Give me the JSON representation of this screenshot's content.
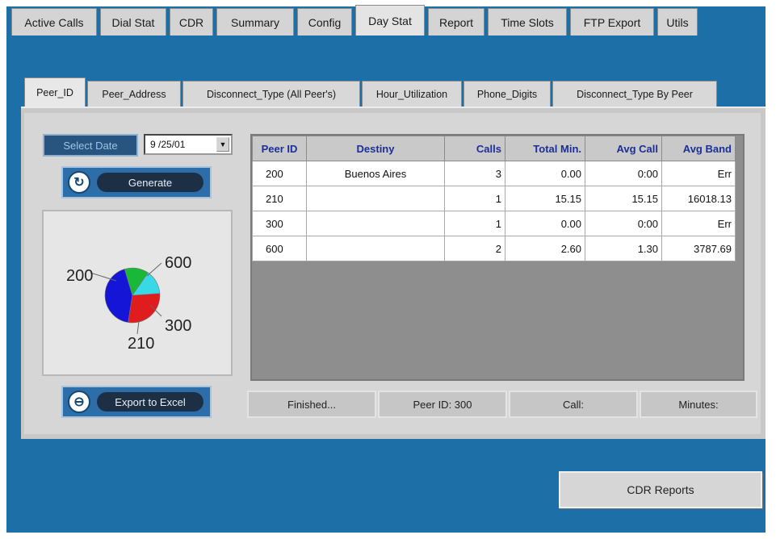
{
  "top_tabs": [
    {
      "label": "Active Calls"
    },
    {
      "label": "Dial Stat"
    },
    {
      "label": "CDR"
    },
    {
      "label": "Summary"
    },
    {
      "label": "Config"
    },
    {
      "label": "Day Stat"
    },
    {
      "label": "Report"
    },
    {
      "label": "Time Slots"
    },
    {
      "label": "FTP Export"
    },
    {
      "label": "Utils"
    }
  ],
  "top_tabs_active": "Day Stat",
  "sub_tabs": [
    {
      "label": "Peer_ID"
    },
    {
      "label": "Peer_Address"
    },
    {
      "label": "Disconnect_Type (All Peer's)"
    },
    {
      "label": "Hour_Utilization"
    },
    {
      "label": "Phone_Digits"
    },
    {
      "label": "Disconnect_Type By Peer"
    }
  ],
  "sub_tabs_active": "Peer_ID",
  "controls": {
    "select_date_label": "Select Date",
    "date_value": "9 /25/01",
    "generate_label": "Generate",
    "export_label": "Export to Excel"
  },
  "pie": {
    "labels": [
      "200",
      "600",
      "300",
      "210"
    ],
    "slices": [
      {
        "peer": "200",
        "value": 3,
        "color": "#1515d8"
      },
      {
        "peer": "210",
        "value": 1,
        "color": "#19b838"
      },
      {
        "peer": "300",
        "value": 1,
        "color": "#38d8e6"
      },
      {
        "peer": "600",
        "value": 2,
        "color": "#e01c1c"
      }
    ]
  },
  "table": {
    "headers": [
      "Peer ID",
      "Destiny",
      "Calls",
      "Total Min.",
      "Avg Call",
      "Avg Band"
    ],
    "rows": [
      [
        "200",
        "Buenos Aires",
        "3",
        "0.00",
        "0:00",
        "Err"
      ],
      [
        "210",
        "",
        "1",
        "15.15",
        "15.15",
        "16018.13"
      ],
      [
        "300",
        "",
        "1",
        "0.00",
        "0:00",
        "Err"
      ],
      [
        "600",
        "",
        "2",
        "2.60",
        "1.30",
        "3787.69"
      ]
    ]
  },
  "status": {
    "state": "Finished...",
    "peer": "Peer ID: 300",
    "call": "Call:",
    "minutes": "Minutes:"
  },
  "cdr_reports_label": "CDR Reports"
}
